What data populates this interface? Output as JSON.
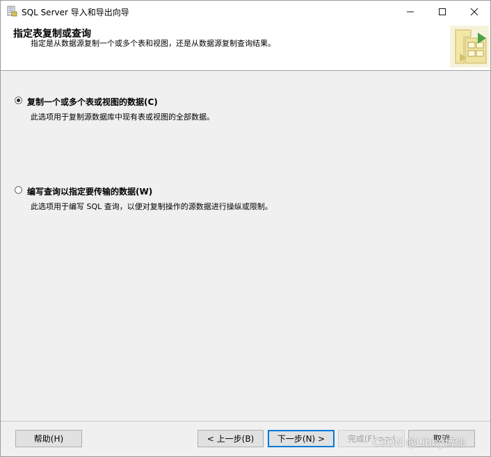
{
  "window": {
    "title": "SQL Server 导入和导出向导",
    "controls": {
      "minimize": "—",
      "maximize": "☐",
      "close": "✕"
    }
  },
  "header": {
    "title": "指定表复制或查询",
    "subtitle": "指定是从数据源复制一个或多个表和视图，还是从数据源复制查询结果。"
  },
  "options": [
    {
      "label": "复制一个或多个表或视图的数据(C)",
      "description": "此选项用于复制源数据库中现有表或视图的全部数据。",
      "selected": true
    },
    {
      "label": "编写查询以指定要传输的数据(W)",
      "description": "此选项用于编写 SQL 查询，以便对复制操作的源数据进行操纵或限制。",
      "selected": false
    }
  ],
  "footer": {
    "help": "帮助(H)",
    "back": "< 上一步(B)",
    "next": "下一步(N) >",
    "finish": "完成(F) >>|",
    "cancel": "取消"
  },
  "watermark": "CSDN @Libby博仙",
  "colors": {
    "accent": "#0078d7",
    "header_bg": "#ffffff",
    "body_bg": "#f0f0f0"
  },
  "icons": {
    "app": "wizard-app-icon",
    "wizard": "table-copy-wizard-icon"
  }
}
